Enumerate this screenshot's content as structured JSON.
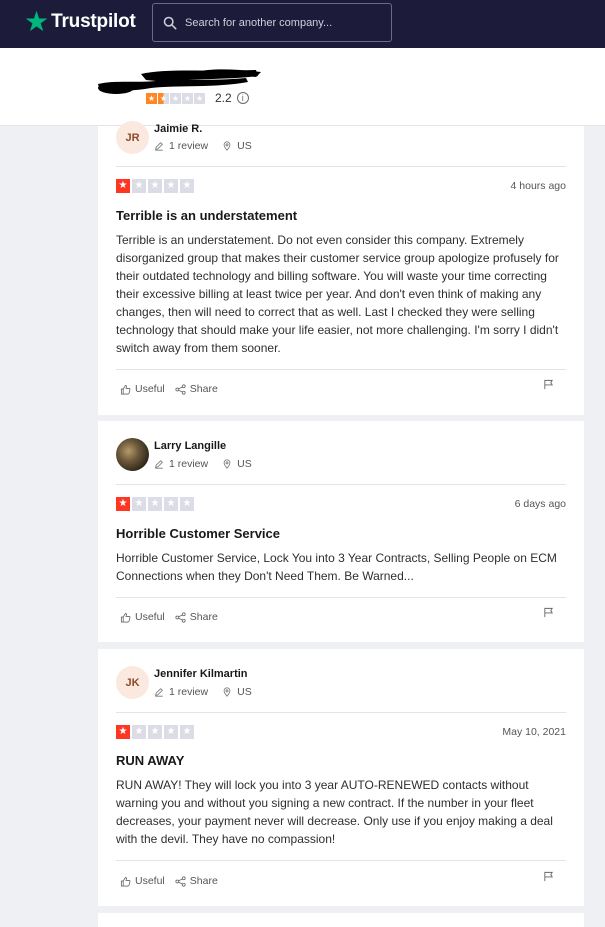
{
  "header": {
    "brand": "Trustpilot",
    "search_placeholder": "Search for another company..."
  },
  "company": {
    "rating": "2.2",
    "stars_filled": 2,
    "stars_total": 5,
    "info_glyph": "i"
  },
  "colors": {
    "topbar": "#1c1c3a",
    "brand_green": "#00b67a",
    "one_star_red": "#ff3722",
    "two_star_orange": "#ff8622",
    "empty_star": "#dcdce6"
  },
  "reviews": [
    {
      "initials": "JR",
      "name": "Jaimie R.",
      "review_count": "1 review",
      "country": "US",
      "stars": 1,
      "date": "4 hours ago",
      "title": "Terrible is an understatement",
      "text": "Terrible is an understatement. Do not even consider this company. Extremely disorganized group that makes their customer service group apologize profusely for their outdated technology and billing software. You will waste your time correcting their excessive billing at least twice per year. And don't even think of making any changes, then will need to correct that as well. Last I checked they were selling technology that should make your life easier, not more challenging. I'm sorry I didn't switch away from them sooner.",
      "useful": "Useful",
      "share": "Share"
    },
    {
      "initials": "",
      "name": "Larry Langille",
      "review_count": "1 review",
      "country": "US",
      "stars": 1,
      "date": "6 days ago",
      "title": "Horrible Customer Service",
      "text": "Horrible Customer Service, Lock You into 3 Year Contracts, Selling People on ECM Connections when they Don't Need Them. Be Warned...",
      "useful": "Useful",
      "share": "Share"
    },
    {
      "initials": "JK",
      "name": "Jennifer Kilmartin",
      "review_count": "1 review",
      "country": "US",
      "stars": 1,
      "date": "May 10, 2021",
      "title": "RUN AWAY",
      "text": "RUN AWAY! They will lock you into 3 year AUTO-RENEWED contacts without warning you and without you signing a new contract. If the number in your fleet decreases, your payment never will decrease. Only use if you enjoy making a deal with the devil. They have no compassion!",
      "useful": "Useful",
      "share": "Share"
    }
  ]
}
